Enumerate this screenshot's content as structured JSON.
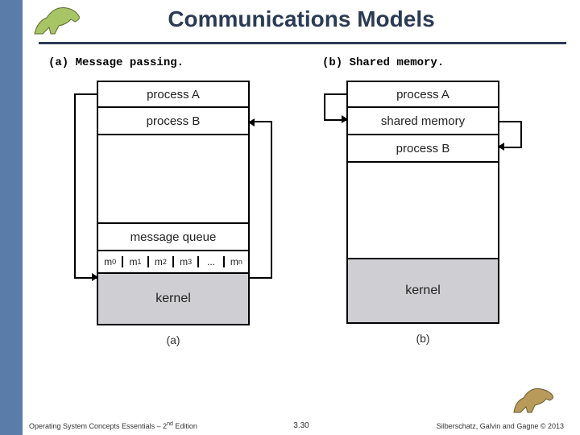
{
  "title": "Communications Models",
  "subtitle_a": "(a) Message passing.",
  "subtitle_b": "(b) Shared memory.",
  "diagram_a": {
    "rows": {
      "process_a": "process A",
      "process_b": "process B",
      "message_queue": "message queue",
      "slots": [
        "m0",
        "m1",
        "m2",
        "m3",
        "...",
        "mn"
      ],
      "kernel": "kernel"
    },
    "caption": "(a)"
  },
  "diagram_b": {
    "rows": {
      "process_a": "process A",
      "shared_memory": "shared memory",
      "process_b": "process B",
      "kernel": "kernel"
    },
    "caption": "(b)"
  },
  "footer": {
    "left": "Operating System Concepts Essentials – 2nd Edition",
    "center": "3.30",
    "right": "Silberschatz, Galvin and Gagne © 2013"
  }
}
